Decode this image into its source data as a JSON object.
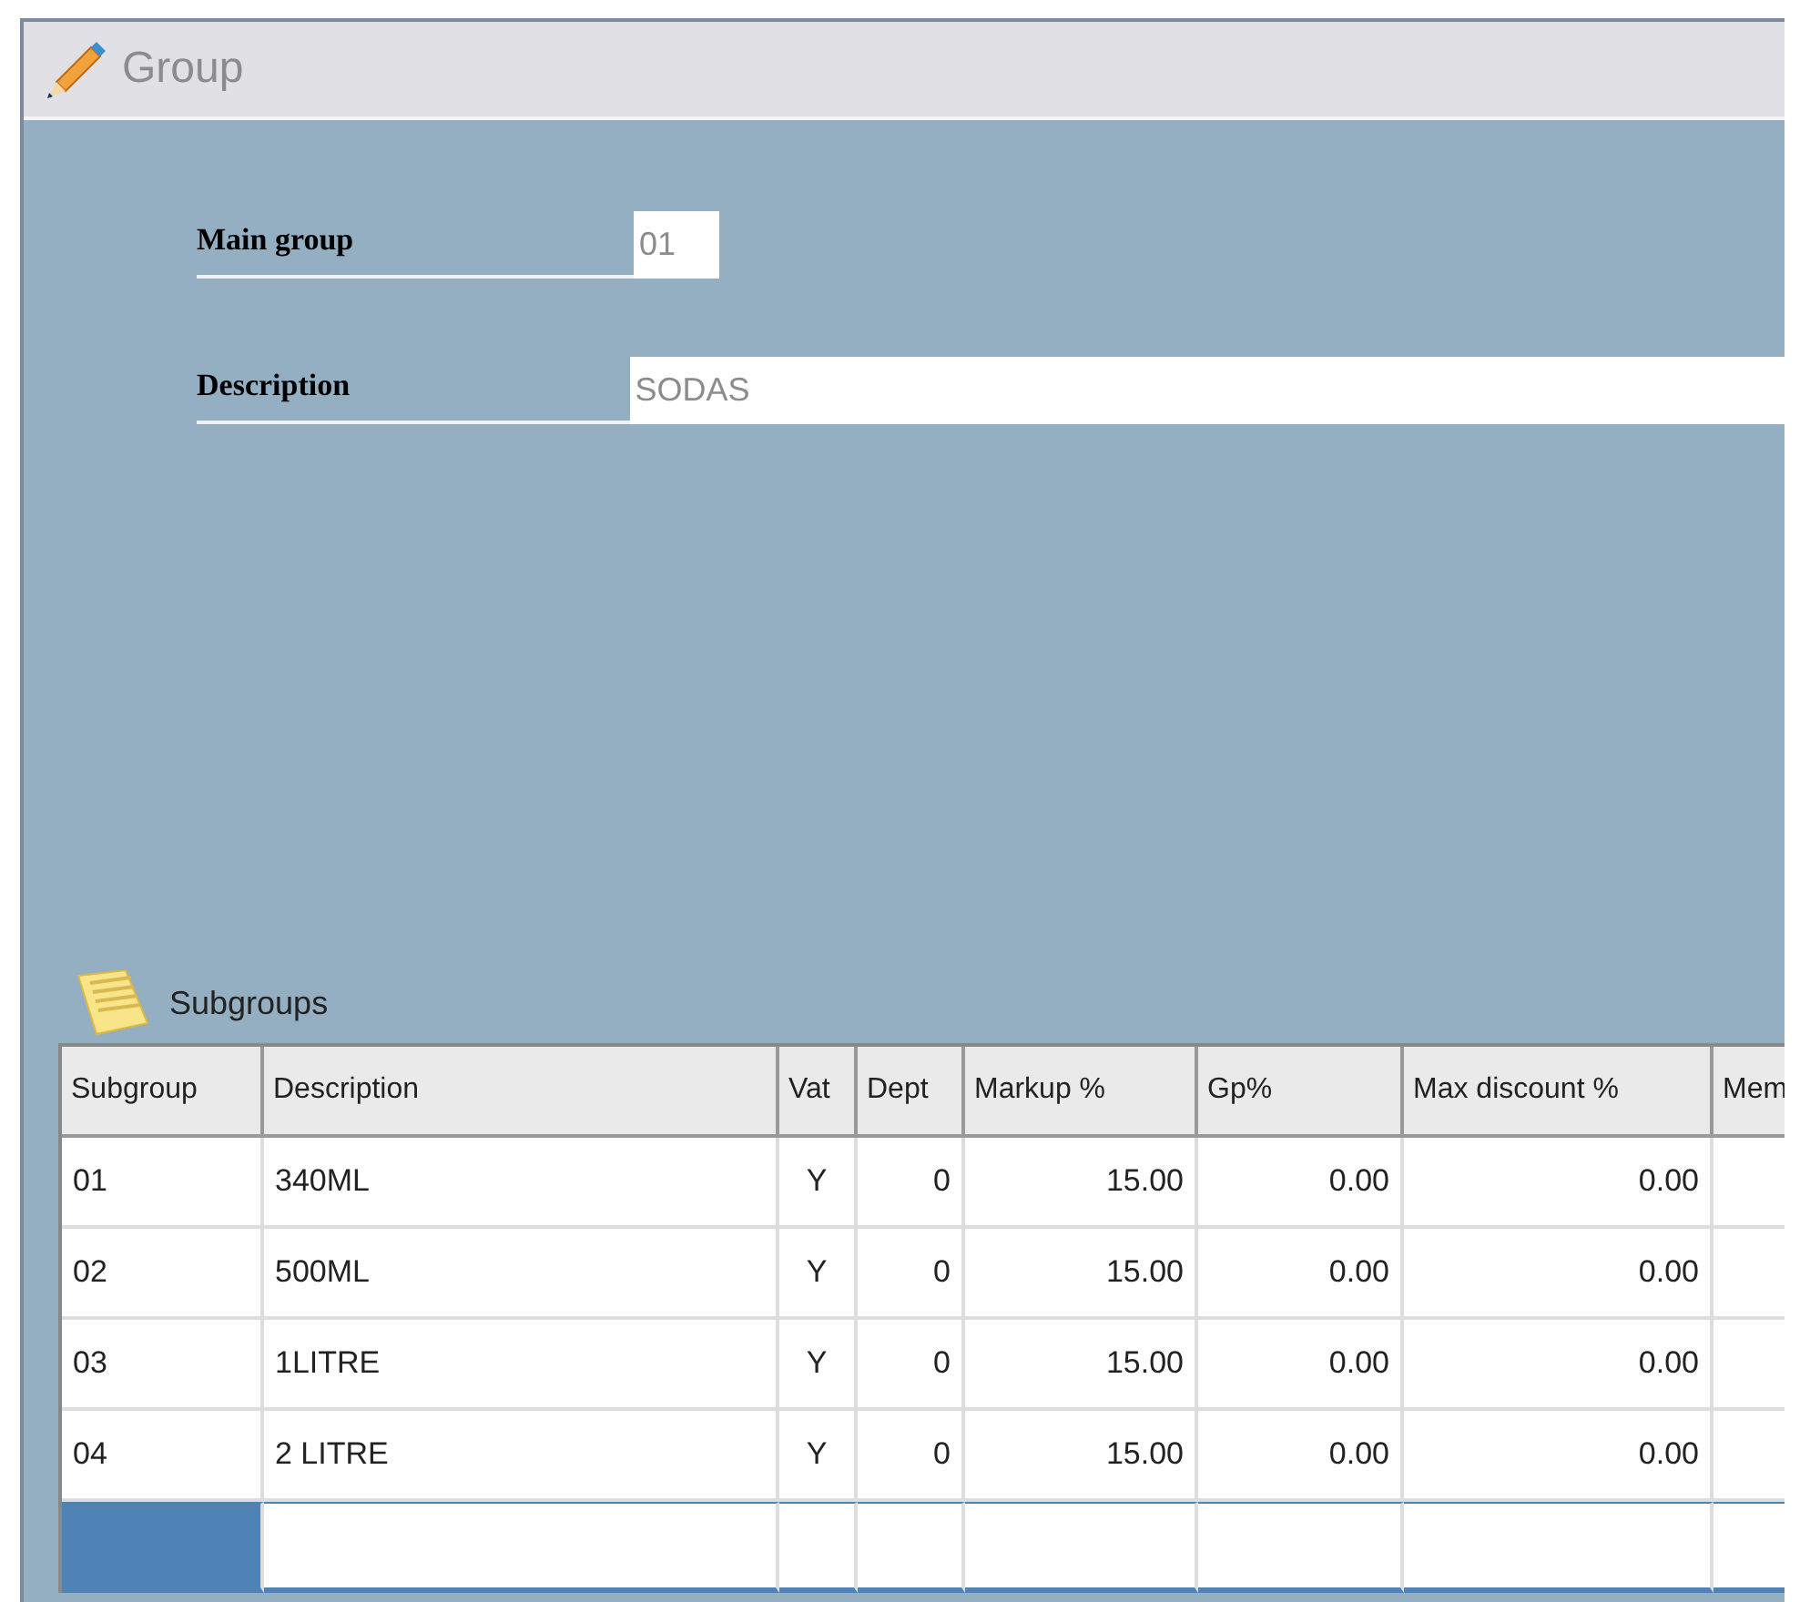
{
  "window": {
    "title": "Group"
  },
  "form": {
    "fields": [
      {
        "label": "Main group",
        "value": "01",
        "kind": "short"
      },
      {
        "label": "Description",
        "value": "SODAS",
        "kind": "wide"
      }
    ]
  },
  "subgroups": {
    "title": "Subgroups",
    "columns": [
      "Subgroup",
      "Description",
      "Vat",
      "Dept",
      "Markup %",
      "Gp%",
      "Max discount %",
      "Mem"
    ],
    "rows": [
      [
        "01",
        "340ML",
        "Y",
        "0",
        "15.00",
        "0.00",
        "0.00"
      ],
      [
        "02",
        "500ML",
        "Y",
        "0",
        "15.00",
        "0.00",
        "0.00"
      ],
      [
        "03",
        "1LITRE",
        "Y",
        "0",
        "15.00",
        "0.00",
        "0.00"
      ],
      [
        "04",
        "2 LITRE",
        "Y",
        "0",
        "15.00",
        "0.00",
        "0.00"
      ]
    ],
    "entry_row": {
      "selected": true
    }
  }
}
